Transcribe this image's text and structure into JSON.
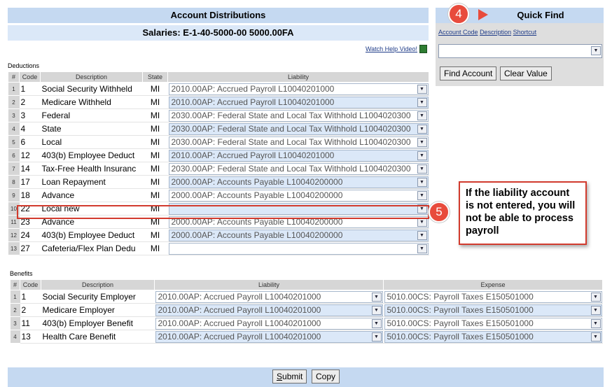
{
  "header": {
    "title": "Account Distributions",
    "subtitle": "Salaries: E-1-40-5000-00 5000.00FA",
    "help_link": "Watch Help Video!"
  },
  "quick_find": {
    "title": "Quick Find",
    "links": [
      "Account Code",
      "Description",
      "Shortcut"
    ],
    "selected_value": "",
    "find_button": "Find Account",
    "clear_button": "Clear Value"
  },
  "deductions": {
    "label": "Deductions",
    "columns": [
      "#",
      "Code",
      "Description",
      "State",
      "Liability"
    ],
    "rows": [
      {
        "n": "1",
        "code": "1",
        "desc": "Social Security Withheld",
        "state": "MI",
        "liability": "2010.00AP: Accrued Payroll L10040201000"
      },
      {
        "n": "2",
        "code": "2",
        "desc": "Medicare Withheld",
        "state": "MI",
        "liability": "2010.00AP: Accrued Payroll L10040201000"
      },
      {
        "n": "3",
        "code": "3",
        "desc": "Federal",
        "state": "MI",
        "liability": "2030.00AP: Federal  State and Local Tax Withhold L1004020300"
      },
      {
        "n": "4",
        "code": "4",
        "desc": "State",
        "state": "MI",
        "liability": "2030.00AP: Federal  State and Local Tax Withhold L1004020300"
      },
      {
        "n": "5",
        "code": "6",
        "desc": "Local",
        "state": "MI",
        "liability": "2030.00AP: Federal  State and Local Tax Withhold L1004020300"
      },
      {
        "n": "6",
        "code": "12",
        "desc": "403(b) Employee Deduct",
        "state": "MI",
        "liability": "2010.00AP: Accrued Payroll L10040201000"
      },
      {
        "n": "7",
        "code": "14",
        "desc": "Tax-Free Health Insuranc",
        "state": "MI",
        "liability": "2030.00AP: Federal  State and Local Tax Withhold L1004020300"
      },
      {
        "n": "8",
        "code": "17",
        "desc": "Loan Repayment",
        "state": "MI",
        "liability": "2000.00AP: Accounts Payable L10040200000"
      },
      {
        "n": "9",
        "code": "18",
        "desc": "Advance",
        "state": "MI",
        "liability": "2000.00AP: Accounts Payable L10040200000"
      },
      {
        "n": "10",
        "code": "22",
        "desc": "Local new",
        "state": "MI",
        "liability": ""
      },
      {
        "n": "11",
        "code": "23",
        "desc": "Advance",
        "state": "MI",
        "liability": "2000.00AP: Accounts Payable L10040200000"
      },
      {
        "n": "12",
        "code": "24",
        "desc": "403(b) Employee Deduct",
        "state": "MI",
        "liability": "2000.00AP: Accounts Payable L10040200000"
      },
      {
        "n": "13",
        "code": "27",
        "desc": "Cafeteria/Flex Plan Dedu",
        "state": "MI",
        "liability": ""
      }
    ]
  },
  "benefits": {
    "label": "Benefits",
    "columns": [
      "#",
      "Code",
      "Description",
      "Liability",
      "Expense"
    ],
    "rows": [
      {
        "n": "1",
        "code": "1",
        "desc": "Social Security Employer",
        "liability": "2010.00AP: Accrued Payroll L10040201000",
        "expense": "5010.00CS: Payroll Taxes E150501000"
      },
      {
        "n": "2",
        "code": "2",
        "desc": "Medicare Employer",
        "liability": "2010.00AP: Accrued Payroll L10040201000",
        "expense": "5010.00CS: Payroll Taxes E150501000"
      },
      {
        "n": "3",
        "code": "11",
        "desc": "403(b) Employer Benefit",
        "liability": "2010.00AP: Accrued Payroll L10040201000",
        "expense": "5010.00CS: Payroll Taxes E150501000"
      },
      {
        "n": "4",
        "code": "13",
        "desc": "Health Care Benefit",
        "liability": "2010.00AP: Accrued Payroll L10040201000",
        "expense": "5010.00CS: Payroll Taxes E150501000"
      }
    ]
  },
  "annotations": {
    "marker_4": "4",
    "marker_5": "5",
    "note": "If the liability account is not entered, you will not be able to process payroll"
  },
  "footer": {
    "submit_accel": "S",
    "submit_rest": "ubmit",
    "copy_label": "Copy"
  },
  "colors": {
    "header_bg": "#c5d9f1",
    "alt_row": "#dbe8f8",
    "annotation_red": "#e84b3c"
  }
}
